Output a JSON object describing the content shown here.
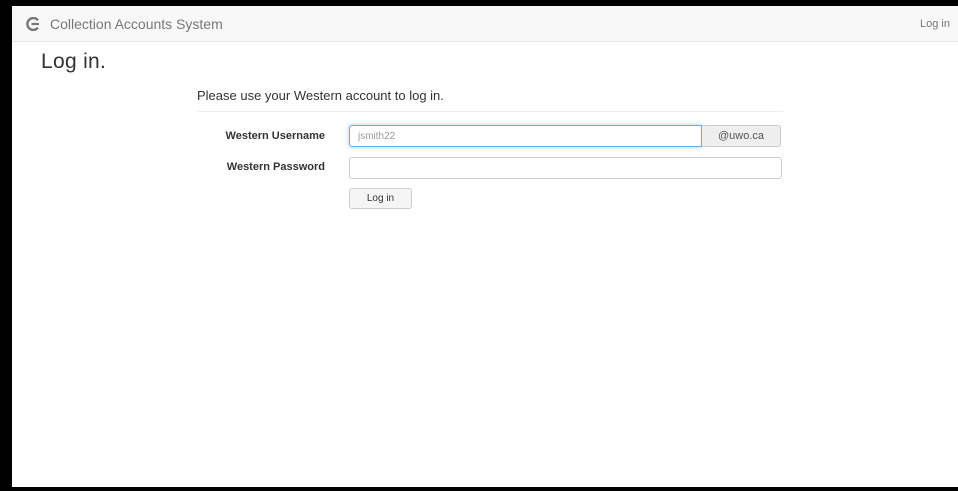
{
  "navbar": {
    "brand_icon": "swirl-logo-icon",
    "brand_text": "Collection Accounts System",
    "login_link": "Log in"
  },
  "page": {
    "title": "Log in.",
    "intro": "Please use your Western account to log in."
  },
  "form": {
    "username_label": "Western Username",
    "username_placeholder": "jsmith22",
    "username_value": "",
    "username_addon": "@uwo.ca",
    "password_label": "Western Password",
    "password_value": "",
    "submit_label": "Log in"
  },
  "colors": {
    "navbar_bg": "#f8f8f8",
    "focus_border": "#66afe9",
    "text": "#333333",
    "muted": "#777777"
  }
}
